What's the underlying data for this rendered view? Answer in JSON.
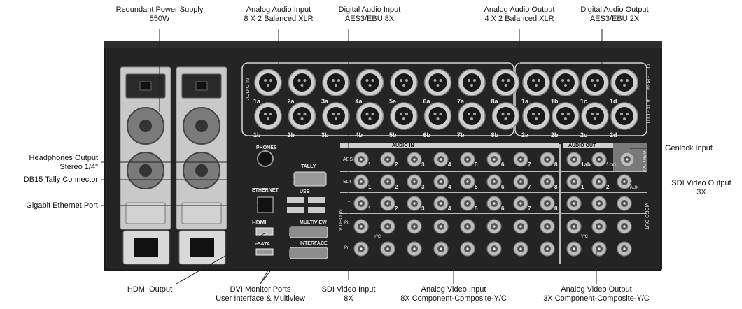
{
  "callouts": {
    "power_supply": {
      "line1": "Redundant Power Supply",
      "line2": "550W"
    },
    "analog_audio_in": {
      "line1": "Analog Audio Input",
      "line2": "8 X 2 Balanced XLR"
    },
    "digital_audio_in": {
      "line1": "Digital Audio Input",
      "line2": "AES3/EBU 8X"
    },
    "analog_audio_out": {
      "line1": "Analog Audio Output",
      "line2": "4 X 2 Balanced XLR"
    },
    "digital_audio_out": {
      "line1": "Digital Audio Output",
      "line2": "AES3/EBU 2X"
    },
    "headphones": {
      "line1": "Headphones Output",
      "line2": "Stereo 1/4\""
    },
    "tally": {
      "line1": "DB15 Tally Connector"
    },
    "ethernet": {
      "line1": "Gigabit Ethernet Port"
    },
    "genlock": {
      "line1": "Genlock Input"
    },
    "sdi_out": {
      "line1": "SDI Video Output",
      "line2": "3X"
    },
    "hdmi_out": {
      "line1": "HDMI Output"
    },
    "dvi": {
      "line1": "DVI Monitor Ports",
      "line2": "User Interface & Multiview"
    },
    "sdi_in": {
      "line1": "SDI Video Input",
      "line2": "8X"
    },
    "analog_video_in": {
      "line1": "Analog Video Input",
      "line2": "8X Component-Composite-Y/C"
    },
    "analog_video_out": {
      "line1": "Analog Video Output",
      "line2": "3X Component-Composite-Y/C"
    }
  },
  "panel": {
    "audio_in_side": "AUDIO IN",
    "audio_in_rows": {
      "top": [
        "1a",
        "2a",
        "3a",
        "4a",
        "5a",
        "6a",
        "7a",
        "8a"
      ],
      "bottom": [
        "1b",
        "2b",
        "3b",
        "4b",
        "5b",
        "6b",
        "7b",
        "8b"
      ]
    },
    "audio_out_rows": {
      "top": [
        "1a",
        "1b",
        "1c",
        "1d"
      ],
      "bottom": [
        "2a",
        "2b",
        "2c",
        "2d"
      ]
    },
    "out_side_top": "OUT - PGM",
    "out_side_bottom": "AUX - OUT",
    "phones": "PHONES",
    "tally": "TALLY",
    "ethernet": "ETHERNET",
    "usb": "USB",
    "hdmi": "HDMI",
    "esata": "eSATA",
    "multiview": "MULTIVIEW",
    "interface": "INTERFACE",
    "audio_in_bar": "AUDIO IN",
    "audio_out_bar": "AUDIO OUT",
    "aes": "AES",
    "sdi": "SDI",
    "y": "Y",
    "pb": "Pb",
    "pr": "Pr",
    "yc": "Y/C",
    "video_in_side": "VIDEO IN",
    "video_out_side": "VIDEO OUT",
    "gen_lock": "GEN LOCK",
    "aux": "AUX",
    "numbers": [
      "1",
      "2",
      "3",
      "4",
      "5",
      "6",
      "7",
      "8"
    ],
    "out_aes": [
      "1ab",
      "1cd"
    ],
    "out_numbers": [
      "1",
      "2"
    ]
  }
}
